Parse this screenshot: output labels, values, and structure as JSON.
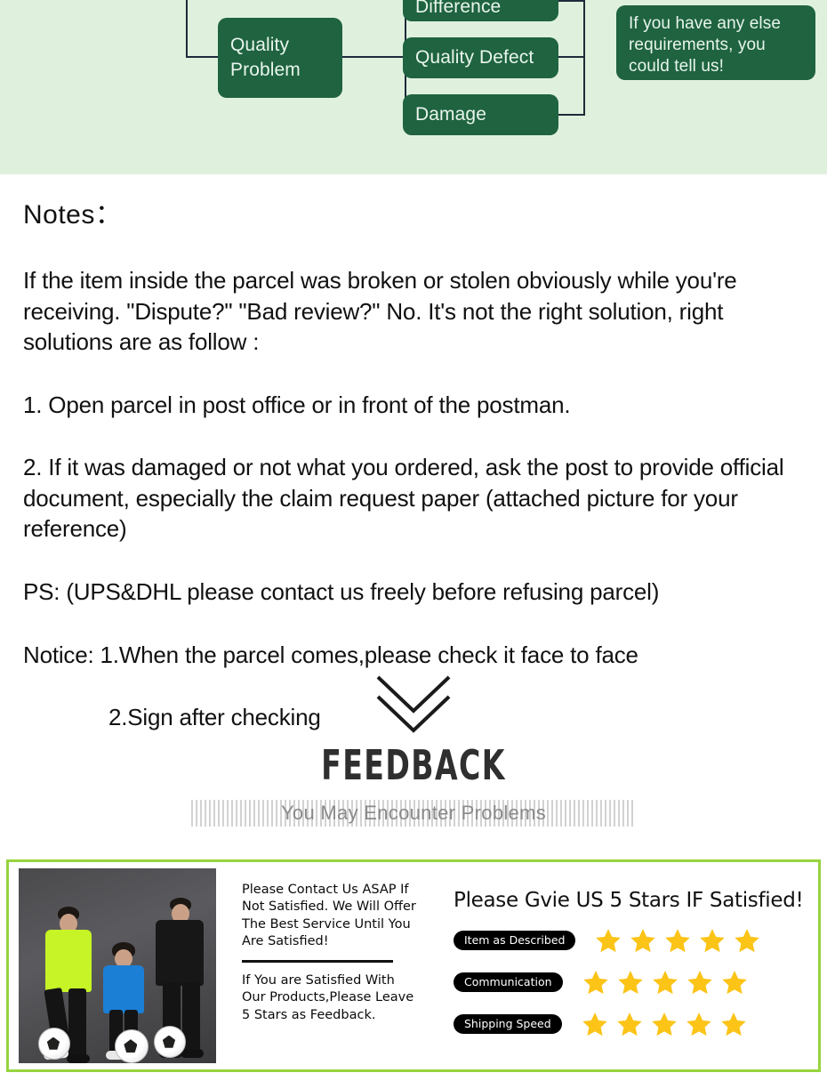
{
  "flowchart": {
    "bg_color": "#dff1dc",
    "node_color": "#1f6340",
    "nodes": {
      "quality_problem": "Quality\nProblem",
      "quality_problem_line1": "Quality",
      "quality_problem_line2": "Problem",
      "color_difference": "Color Difference",
      "quality_defect": "Quality Defect",
      "damage": "Damage",
      "requirements": "If you have any else requirements, you could tell us!"
    }
  },
  "notes": {
    "title": "Notes：",
    "paragraphs": [
      "If the item inside the parcel was broken or stolen obviously while you're receiving. \"Dispute?\" \"Bad review?\"  No. It's not the right solution, right solutions are as follow :",
      "1. Open parcel in post office or in front of the postman.",
      "2. If it was damaged or not what you ordered, ask the post to provide official document, especially the claim request paper (attached picture for your reference)",
      "PS: (UPS&DHL please contact us freely before refusing parcel)",
      "Notice: 1.When the parcel comes,please check it face to face",
      "2.Sign after checking"
    ]
  },
  "feedback": {
    "icon": "chevron-down-icon",
    "title": "FEEDBACK",
    "subtitle": "You May Encounter Problems"
  },
  "service_panel": {
    "border_color": "#97d43e",
    "photo_alt": "two men and a boy in tracksuits with soccer balls",
    "contact": {
      "primary": "Please Contact Us ASAP If Not Satisfied. We Will Offer The Best Service Until You Are Satisfied!",
      "secondary": "If You are Satisfied With Our Products,Please Leave 5 Stars as Feedback."
    },
    "rating": {
      "title": "Please Gvie US 5 Stars IF Satisfied!",
      "star_color": "#fbc417",
      "rows": [
        {
          "label": "Item as Described",
          "stars": 5
        },
        {
          "label": "Communication",
          "stars": 5
        },
        {
          "label": "Shipping Speed",
          "stars": 5
        }
      ]
    }
  }
}
